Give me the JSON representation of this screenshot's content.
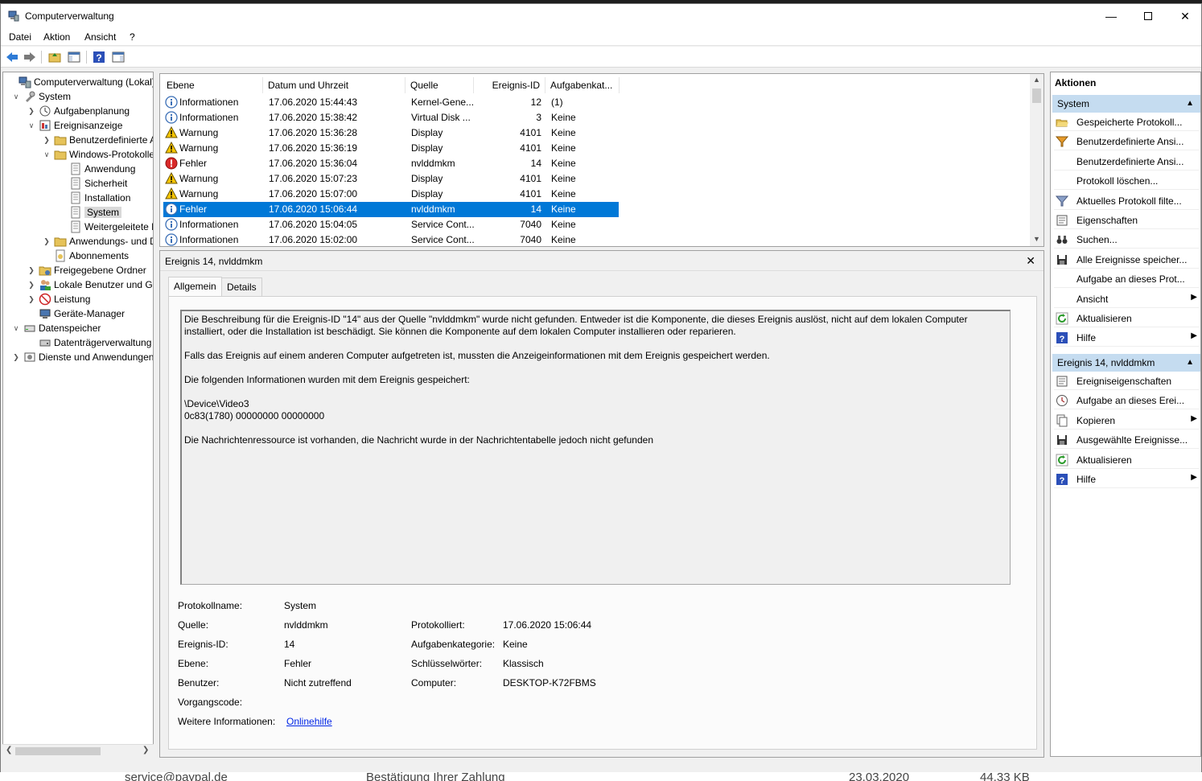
{
  "window": {
    "title": "Computerverwaltung"
  },
  "menu": [
    "Datei",
    "Aktion",
    "Ansicht",
    "?"
  ],
  "tree": [
    {
      "label": "Computerverwaltung (Lokal)",
      "indent": 0,
      "exp": "",
      "icon": "computer-mgmt-icon"
    },
    {
      "label": "System",
      "indent": 1,
      "exp": "v",
      "icon": "tools-icon"
    },
    {
      "label": "Aufgabenplanung",
      "indent": 2,
      "exp": ">",
      "icon": "clock-icon"
    },
    {
      "label": "Ereignisanzeige",
      "indent": 2,
      "exp": "v",
      "icon": "event-viewer-icon"
    },
    {
      "label": "Benutzerdefinierte A",
      "indent": 3,
      "exp": ">",
      "icon": "folder-icon"
    },
    {
      "label": "Windows-Protokolle",
      "indent": 3,
      "exp": "v",
      "icon": "folder-icon"
    },
    {
      "label": "Anwendung",
      "indent": 4,
      "exp": "",
      "icon": "log-icon"
    },
    {
      "label": "Sicherheit",
      "indent": 4,
      "exp": "",
      "icon": "log-icon"
    },
    {
      "label": "Installation",
      "indent": 4,
      "exp": "",
      "icon": "log-icon"
    },
    {
      "label": "System",
      "indent": 4,
      "exp": "",
      "icon": "log-icon",
      "selected": true
    },
    {
      "label": "Weitergeleitete E",
      "indent": 4,
      "exp": "",
      "icon": "log-icon"
    },
    {
      "label": "Anwendungs- und D",
      "indent": 3,
      "exp": ">",
      "icon": "folder-icon"
    },
    {
      "label": "Abonnements",
      "indent": 3,
      "exp": "",
      "icon": "subscription-icon"
    },
    {
      "label": "Freigegebene Ordner",
      "indent": 2,
      "exp": ">",
      "icon": "shared-folder-icon"
    },
    {
      "label": "Lokale Benutzer und Gr",
      "indent": 2,
      "exp": ">",
      "icon": "users-icon"
    },
    {
      "label": "Leistung",
      "indent": 2,
      "exp": ">",
      "icon": "performance-icon"
    },
    {
      "label": "Geräte-Manager",
      "indent": 2,
      "exp": "",
      "icon": "device-manager-icon"
    },
    {
      "label": "Datenspeicher",
      "indent": 1,
      "exp": "v",
      "icon": "storage-icon"
    },
    {
      "label": "Datenträgerverwaltung",
      "indent": 2,
      "exp": "",
      "icon": "disk-icon"
    },
    {
      "label": "Dienste und Anwendungen",
      "indent": 1,
      "exp": ">",
      "icon": "services-icon"
    }
  ],
  "list": {
    "headers": [
      "Ebene",
      "Datum und Uhrzeit",
      "Quelle",
      "Ereignis-ID",
      "Aufgabenkat..."
    ],
    "rows": [
      {
        "level": "Informationen",
        "type": "info",
        "date": "17.06.2020 15:44:43",
        "source": "Kernel-Gene...",
        "id": "12",
        "cat": "(1)"
      },
      {
        "level": "Informationen",
        "type": "info",
        "date": "17.06.2020 15:38:42",
        "source": "Virtual Disk ...",
        "id": "3",
        "cat": "Keine"
      },
      {
        "level": "Warnung",
        "type": "warn",
        "date": "17.06.2020 15:36:28",
        "source": "Display",
        "id": "4101",
        "cat": "Keine"
      },
      {
        "level": "Warnung",
        "type": "warn",
        "date": "17.06.2020 15:36:19",
        "source": "Display",
        "id": "4101",
        "cat": "Keine"
      },
      {
        "level": "Fehler",
        "type": "error",
        "date": "17.06.2020 15:36:04",
        "source": "nvlddmkm",
        "id": "14",
        "cat": "Keine"
      },
      {
        "level": "Warnung",
        "type": "warn",
        "date": "17.06.2020 15:07:23",
        "source": "Display",
        "id": "4101",
        "cat": "Keine"
      },
      {
        "level": "Warnung",
        "type": "warn",
        "date": "17.06.2020 15:07:00",
        "source": "Display",
        "id": "4101",
        "cat": "Keine"
      },
      {
        "level": "Fehler",
        "type": "error",
        "date": "17.06.2020 15:06:44",
        "source": "nvlddmkm",
        "id": "14",
        "cat": "Keine",
        "selected": true
      },
      {
        "level": "Informationen",
        "type": "info",
        "date": "17.06.2020 15:04:05",
        "source": "Service Cont...",
        "id": "7040",
        "cat": "Keine"
      },
      {
        "level": "Informationen",
        "type": "info",
        "date": "17.06.2020 15:02:00",
        "source": "Service Cont...",
        "id": "7040",
        "cat": "Keine"
      }
    ]
  },
  "detail": {
    "title": "Ereignis 14, nvlddmkm",
    "tab_general": "Allgemein",
    "tab_details": "Details",
    "description": [
      "Die Beschreibung für die Ereignis-ID \"14\" aus der Quelle \"nvlddmkm\" wurde nicht gefunden. Entweder ist die Komponente, die dieses Ereignis auslöst, nicht auf dem lokalen Computer installiert, oder die Installation ist beschädigt. Sie können die Komponente auf dem lokalen Computer installieren oder reparieren.",
      "",
      "Falls das Ereignis auf einem anderen Computer aufgetreten ist, mussten die Anzeigeinformationen mit dem Ereignis gespeichert werden.",
      "",
      "Die folgenden Informationen wurden mit dem Ereignis gespeichert:",
      "",
      "\\Device\\Video3",
      "0c83(1780) 00000000 00000000",
      "",
      "Die Nachrichtenressource ist vorhanden, die Nachricht wurde in der Nachrichtentabelle jedoch nicht gefunden"
    ],
    "props": {
      "log_label": "Protokollname:",
      "log_value": "System",
      "source_label": "Quelle:",
      "source_value": "nvlddmkm",
      "logged_label": "Protokolliert:",
      "logged_value": "17.06.2020 15:06:44",
      "eventid_label": "Ereignis-ID:",
      "eventid_value": "14",
      "taskcat_label": "Aufgabenkategorie:",
      "taskcat_value": "Keine",
      "level_label": "Ebene:",
      "level_value": "Fehler",
      "keywords_label": "Schlüsselwörter:",
      "keywords_value": "Klassisch",
      "user_label": "Benutzer:",
      "user_value": "Nicht zutreffend",
      "computer_label": "Computer:",
      "computer_value": "DESKTOP-K72FBMS",
      "opcode_label": "Vorgangscode:",
      "moreinfo_label": "Weitere Informationen:",
      "moreinfo_link": "Onlinehilfe"
    }
  },
  "actions": {
    "header": "Aktionen",
    "section1": "System",
    "items1": [
      {
        "label": "Gespeicherte Protokoll...",
        "icon": "open-folder-icon"
      },
      {
        "label": "Benutzerdefinierte Ansi...",
        "icon": "filter-add-icon"
      },
      {
        "label": "Benutzerdefinierte Ansi...",
        "icon": ""
      },
      {
        "label": "Protokoll löschen...",
        "icon": ""
      },
      {
        "label": "Aktuelles Protokoll filte...",
        "icon": "filter-icon"
      },
      {
        "label": "Eigenschaften",
        "icon": "properties-icon"
      },
      {
        "label": "Suchen...",
        "icon": "binoculars-icon"
      },
      {
        "label": "Alle Ereignisse speicher...",
        "icon": "save-icon"
      },
      {
        "label": "Aufgabe an dieses Prot...",
        "icon": ""
      },
      {
        "label": "Ansicht",
        "icon": "",
        "sub": true
      },
      {
        "label": "Aktualisieren",
        "icon": "refresh-icon"
      },
      {
        "label": "Hilfe",
        "icon": "help-icon",
        "sub": true
      }
    ],
    "section2": "Ereignis 14, nvlddmkm",
    "items2": [
      {
        "label": "Ereigniseigenschaften",
        "icon": "properties-icon"
      },
      {
        "label": "Aufgabe an dieses Erei...",
        "icon": "task-icon"
      },
      {
        "label": "Kopieren",
        "icon": "copy-icon",
        "sub": true
      },
      {
        "label": "Ausgewählte Ereignisse...",
        "icon": "save-icon"
      },
      {
        "label": "Aktualisieren",
        "icon": "refresh-icon"
      },
      {
        "label": "Hilfe",
        "icon": "help-icon",
        "sub": true
      }
    ]
  },
  "background_strip": [
    "service@paypal.de",
    "Bestätigung Ihrer Zahlung",
    "23.03.2020",
    "44,33 KB"
  ],
  "colors": {
    "selection": "#0078d7",
    "section": "#c5dcf0",
    "link": "#0026e6"
  }
}
